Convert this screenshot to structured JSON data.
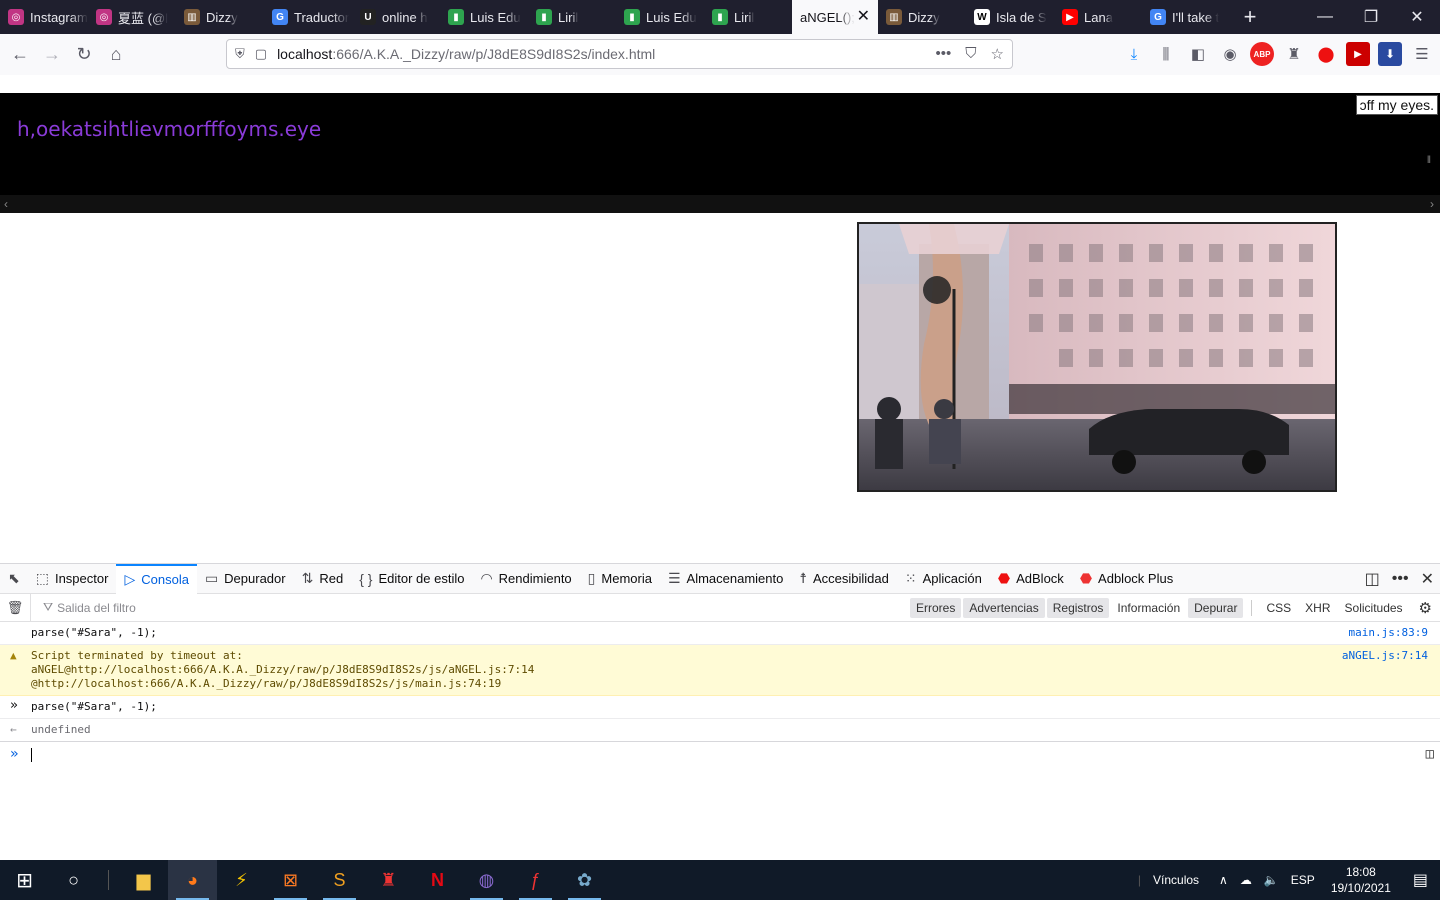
{
  "tabs": [
    {
      "label": "Instagram",
      "icon": "instagram-icon",
      "color": "#c13584",
      "glyph": "◎"
    },
    {
      "label": "夏蓝 (@l",
      "icon": "instagram-icon",
      "color": "#c13584",
      "glyph": "◎"
    },
    {
      "label": "Dizzy",
      "icon": "dizzy-icon",
      "color": "#7a5a3a",
      "glyph": "▥"
    },
    {
      "label": "Traductor",
      "icon": "google-translate-icon",
      "color": "#4285f4",
      "glyph": "G"
    },
    {
      "label": "online h",
      "icon": "u-icon",
      "color": "#222222",
      "glyph": "U"
    },
    {
      "label": "Luis Edu",
      "icon": "chart-icon",
      "color": "#2ea44f",
      "glyph": "▮"
    },
    {
      "label": "Liril",
      "icon": "chart-icon",
      "color": "#2ea44f",
      "glyph": "▮"
    },
    {
      "label": "Luis Edu",
      "icon": "chart-icon",
      "color": "#2ea44f",
      "glyph": "▮"
    },
    {
      "label": "Liril",
      "icon": "chart-icon",
      "color": "#2ea44f",
      "glyph": "▮"
    },
    {
      "label": "aNGEL();",
      "icon": "",
      "color": "",
      "glyph": "",
      "active": true
    },
    {
      "label": "Dizzy",
      "icon": "dizzy-icon",
      "color": "#7a5a3a",
      "glyph": "▥"
    },
    {
      "label": "Isla de S",
      "icon": "wikipedia-icon",
      "color": "#ffffff",
      "glyph": "W"
    },
    {
      "label": "Lana",
      "icon": "youtube-icon",
      "color": "#ff0000",
      "glyph": "▶"
    },
    {
      "label": "I'll take t",
      "icon": "google-icon",
      "color": "#4285f4",
      "glyph": "G"
    }
  ],
  "url": {
    "host": "localhost",
    "rest": ":666/A.K.A._Dizzy/raw/p/J8dE8S9dI8S2s/index.html"
  },
  "page": {
    "weird_text": "h,oekatsihtlievmorfffoyms.eye",
    "tooltip": "ɔff my eyes."
  },
  "devtools": {
    "tabs": [
      {
        "label": "Inspector",
        "icon": "inspector-icon",
        "glyph": "⬚"
      },
      {
        "label": "Consola",
        "icon": "console-icon",
        "glyph": "▷",
        "selected": true
      },
      {
        "label": "Depurador",
        "icon": "debugger-icon",
        "glyph": "▭"
      },
      {
        "label": "Red",
        "icon": "network-icon",
        "glyph": "⇅"
      },
      {
        "label": "Editor de estilo",
        "icon": "style-editor-icon",
        "glyph": "{ }"
      },
      {
        "label": "Rendimiento",
        "icon": "performance-icon",
        "glyph": "◠"
      },
      {
        "label": "Memoria",
        "icon": "memory-icon",
        "glyph": "▯"
      },
      {
        "label": "Almacenamiento",
        "icon": "storage-icon",
        "glyph": "☰"
      },
      {
        "label": "Accesibilidad",
        "icon": "accessibility-icon",
        "glyph": "☨"
      },
      {
        "label": "Aplicación",
        "icon": "application-icon",
        "glyph": "⁙"
      },
      {
        "label": "AdBlock",
        "icon": "adblock-icon",
        "glyph": "⬣"
      },
      {
        "label": "Adblock Plus",
        "icon": "adblock-plus-icon",
        "glyph": "⬣"
      }
    ],
    "filter_placeholder": "Salida del filtro",
    "filters": [
      {
        "label": "Errores",
        "on": true
      },
      {
        "label": "Advertencias",
        "on": true
      },
      {
        "label": "Registros",
        "on": true
      },
      {
        "label": "Información",
        "on": false
      },
      {
        "label": "Depurar",
        "on": true
      }
    ],
    "filters2": [
      "CSS",
      "XHR",
      "Solicitudes"
    ],
    "log": [
      {
        "kind": "log",
        "lines": [
          "parse(\"#Sara\", -1);"
        ],
        "src": "main.js:83:9"
      },
      {
        "kind": "warn",
        "lines": [
          "Script terminated by timeout at:",
          "aNGEL@http://localhost:666/A.K.A._Dizzy/raw/p/J8dE8S9dI8S2s/js/aNGEL.js:7:14",
          "@http://localhost:666/A.K.A._Dizzy/raw/p/J8dE8S9dI8S2s/js/main.js:74:19"
        ],
        "src": "aNGEL.js:7:14"
      },
      {
        "kind": "input",
        "lines": [
          "parse(\"#Sara\", -1);"
        ],
        "src": ""
      },
      {
        "kind": "result",
        "lines": [
          "undefined"
        ],
        "src": ""
      }
    ]
  },
  "taskbar": {
    "tray_label": "Vínculos",
    "lang": "ESP",
    "time": "18:08",
    "date": "19/10/2021"
  }
}
